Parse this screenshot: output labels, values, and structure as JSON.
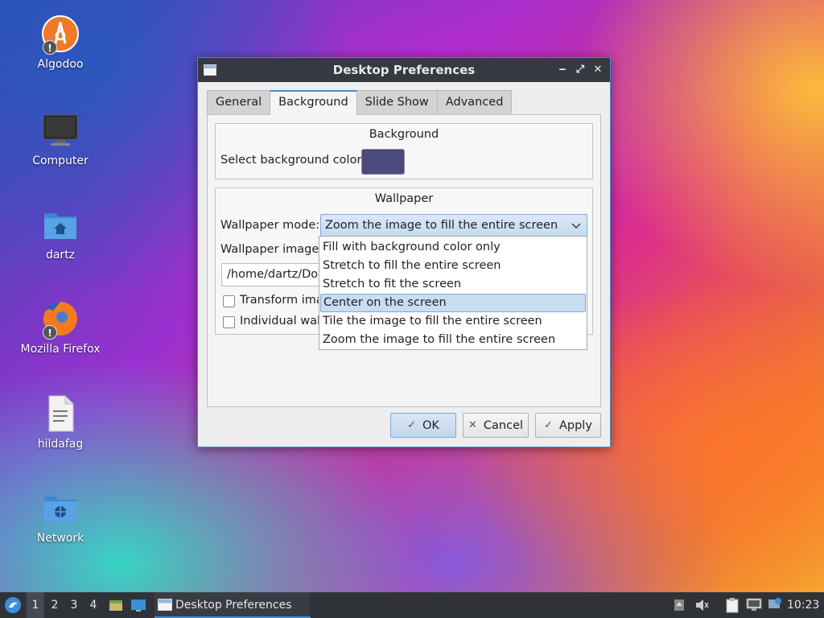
{
  "desktop_icons": [
    {
      "label": "Algodoo",
      "icon": "algodoo-icon"
    },
    {
      "label": "Computer",
      "icon": "monitor-icon"
    },
    {
      "label": "dartz",
      "icon": "home-folder-icon"
    },
    {
      "label": "Mozilla Firefox",
      "icon": "firefox-icon"
    },
    {
      "label": "hildafag",
      "icon": "text-file-icon"
    },
    {
      "label": "Network",
      "icon": "network-folder-icon"
    }
  ],
  "dialog": {
    "title": "Desktop Preferences",
    "window_buttons": {
      "minimize": "‒",
      "maximize": "⤢",
      "close": "✕"
    },
    "tabs": [
      {
        "label": "General"
      },
      {
        "label": "Background"
      },
      {
        "label": "Slide Show"
      },
      {
        "label": "Advanced"
      }
    ],
    "active_tab": "Background",
    "background_section": {
      "title": "Background",
      "color_label": "Select background color:",
      "color_value": "#4b4a7e"
    },
    "wallpaper_section": {
      "title": "Wallpaper",
      "mode_label": "Wallpaper mode:",
      "mode_value": "Zoom the image to fill the entire screen",
      "image_file_label": "Wallpaper image f",
      "image_path": "/home/dartz/Dov",
      "transform_label": "Transform ima",
      "individual_label": "Individual wall"
    },
    "mode_options": [
      "Fill with background color only",
      "Stretch to fill the entire screen",
      "Stretch to fit the screen",
      "Center on the screen",
      "Tile the image to fill the entire screen",
      "Zoom the image to fill the entire screen"
    ],
    "highlighted_option": "Center on the screen",
    "buttons": {
      "ok": "OK",
      "cancel": "Cancel",
      "apply": "Apply"
    }
  },
  "taskbar": {
    "workspaces": [
      "1",
      "2",
      "3",
      "4"
    ],
    "active_workspace": "1",
    "task_label": "Desktop Preferences",
    "clock": "10:23"
  },
  "colors": {
    "accent": "#3b8ed8",
    "titlebar": "#363a40",
    "taskbar": "#2f3338"
  }
}
